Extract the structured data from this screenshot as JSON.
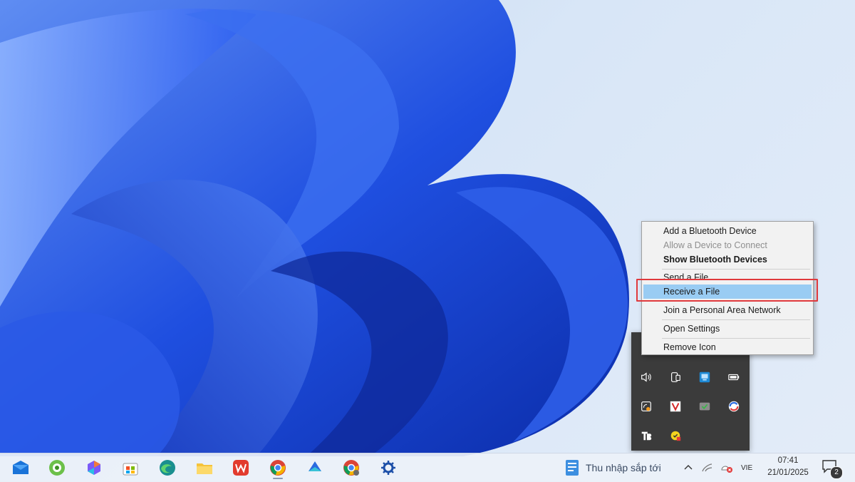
{
  "context_menu": {
    "items": [
      {
        "label": "Add a Bluetooth Device",
        "state": "normal"
      },
      {
        "label": "Allow a Device to Connect",
        "state": "disabled"
      },
      {
        "label": "Show Bluetooth Devices",
        "state": "bold"
      },
      {
        "label": "Send a File",
        "state": "normal"
      },
      {
        "label": "Receive a File",
        "state": "hover"
      },
      {
        "label": "Join a Personal Area Network",
        "state": "normal"
      },
      {
        "label": "Open Settings",
        "state": "normal"
      },
      {
        "label": "Remove Icon",
        "state": "normal"
      }
    ],
    "highlight_color": "#e0393c"
  },
  "tray_flyout": {
    "icons": [
      "speaker-icon",
      "phone-link-icon",
      "network-monitor-icon",
      "battery-icon",
      "update-icon",
      "vivaldi-v-icon",
      "vpn-shield-icon",
      "sync-globe-icon",
      "tb-app-icon",
      "yellow-status-icon"
    ]
  },
  "taskbar": {
    "apps": [
      "mail-icon",
      "copilot-icon",
      "edge-dev-icon",
      "store-icon",
      "edge-icon",
      "file-explorer-icon",
      "wps-office-icon",
      "chrome-icon",
      "app-icon",
      "chrome-profile-icon",
      "settings-icon"
    ],
    "weather_text": "Thu nhập sắp tới",
    "language": "VIE",
    "time": "07:41",
    "date": "21/01/2025",
    "notification_count": "2"
  }
}
